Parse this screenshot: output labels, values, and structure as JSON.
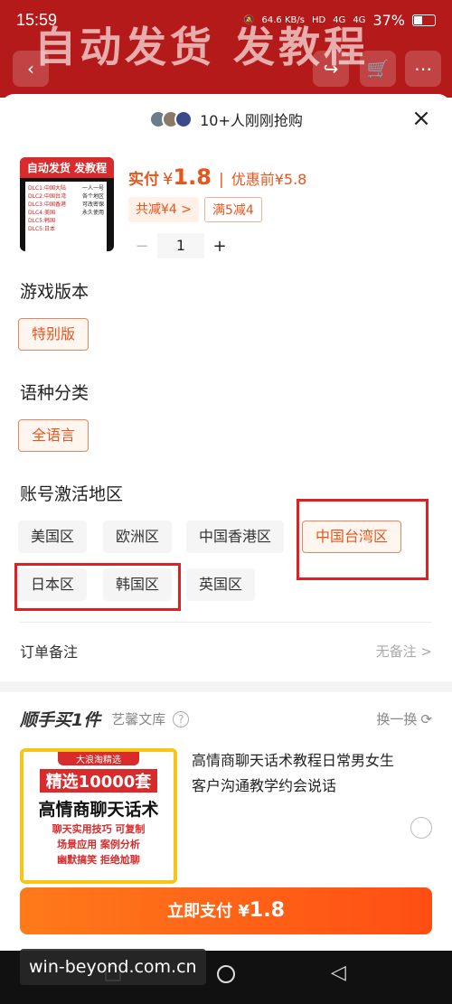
{
  "status_bar": {
    "time": "15:59",
    "net_speed": "64.6 KB/s",
    "hd1": "HD",
    "signal1": "4G",
    "signal2": "4G",
    "battery": "37%"
  },
  "background": {
    "banner_text": "自动发货 发教程"
  },
  "sheet": {
    "hot_text": "10+人刚刚抢购",
    "close_icon": "×"
  },
  "product": {
    "thumb_title": "自动发货 发教程",
    "thumb_lines": [
      "DLC1:中国大陆",
      "DLC2:中国台湾",
      "DLC3:中国香港",
      "DLC4:美国",
      "DLC5:韩国",
      "DLC5:日本"
    ],
    "thumb_right": [
      "一人一号",
      "各个地区",
      "可改密保",
      "永久使用"
    ],
    "price_label": "实付",
    "yen": "¥",
    "price": "1.8",
    "sep": "|",
    "pre_price": "优惠前¥5.8",
    "tag_discount": "共减¥4 >",
    "tag_coupon": "满5减4",
    "qty_minus": "−",
    "qty": "1",
    "qty_plus": "+"
  },
  "sections": {
    "version_title": "游戏版本",
    "version_opts": [
      "特别版"
    ],
    "lang_title": "语种分类",
    "lang_opts": [
      "全语言"
    ],
    "region_title": "账号激活地区",
    "region_opts": [
      "美国区",
      "欧洲区",
      "中国香港区",
      "中国台湾区",
      "日本区",
      "韩国区",
      "英国区"
    ],
    "region_selected": "中国台湾区"
  },
  "remark": {
    "label": "订单备注",
    "value": "无备注 >"
  },
  "add_on": {
    "title": "顺手买1件",
    "shop": "艺馨文库",
    "help": "?",
    "swap": "换一换",
    "thumb_badge": "大浪淘精选",
    "thumb_big": "精选10000套",
    "thumb_main": "高情商聊天话术",
    "thumb_sub": [
      "聊天实用技巧 可复制",
      "场景应用 案例分析",
      "幽默搞笑 拒绝尬聊"
    ],
    "item_title": "高情商聊天话术教程日常男女生客户沟通教学约会说话"
  },
  "pay": {
    "label": "立即支付",
    "yen": "¥",
    "amount": "1.8"
  },
  "watermark": "win-beyond.com.cn",
  "colors": {
    "accent": "#e8551c",
    "highlight_box": "#e02020",
    "banner_red": "#b51a1a"
  }
}
